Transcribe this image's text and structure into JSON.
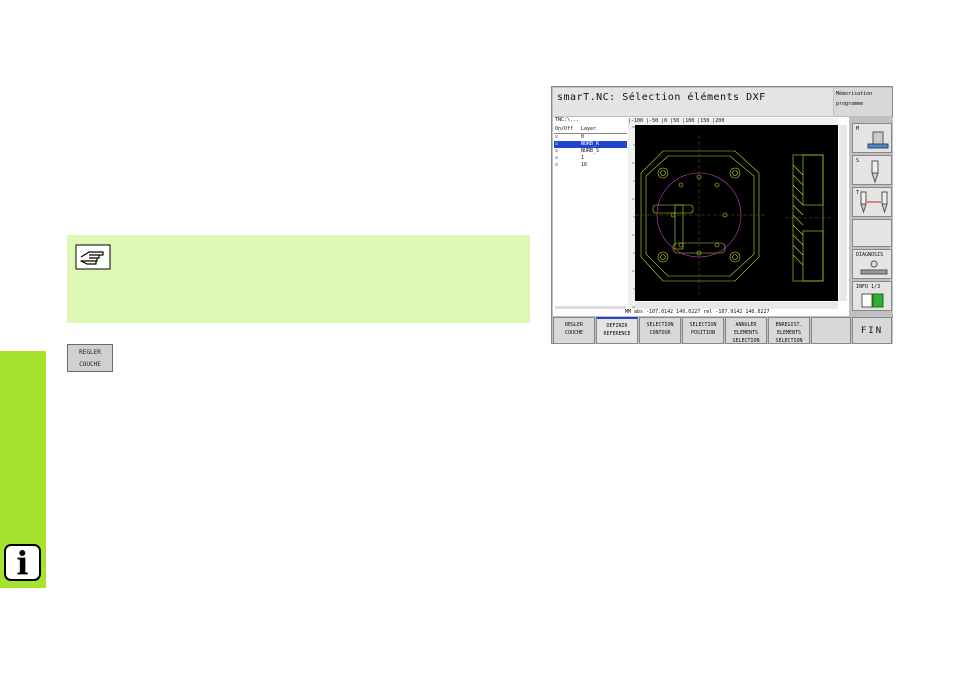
{
  "note_icon": "pointing-hand-icon",
  "softkey_example": {
    "line1": "REGLER",
    "line2": "COUCHE"
  },
  "info_icon": {
    "glyph": "i"
  },
  "screen": {
    "title": "smarT.NC: Sélection éléments DXF",
    "mode": {
      "line1": "Mémorisation",
      "line2": "programme"
    },
    "path": "TNC:\\...",
    "layer_table": {
      "headers": [
        "On/Off",
        "Layer"
      ],
      "rows": [
        {
          "check": "☑",
          "name": "0",
          "selected": false
        },
        {
          "check": "☑",
          "name": "NURB_K",
          "selected": true
        },
        {
          "check": "☑",
          "name": "NURB_S",
          "selected": false
        },
        {
          "check": "☑",
          "name": "1",
          "selected": false
        },
        {
          "check": "☑",
          "name": "16",
          "selected": false
        }
      ]
    },
    "ruler_top": "|-100  |-50  |0   |50  |100 |150  |200",
    "status": "MM   abs -107.0142 140.0227 rel -107.0142 140.0227",
    "right_panel": [
      {
        "label": "M",
        "icon": "spindle-icon"
      },
      {
        "label": "S",
        "icon": "tool-icon"
      },
      {
        "label": "T",
        "icon": "tool-change-icon"
      },
      {
        "label": "",
        "icon": ""
      },
      {
        "label": "DIAGNOSIS",
        "icon": "diagnosis-icon"
      },
      {
        "label": "INFO 1/3",
        "icon": "info-page-icon"
      }
    ],
    "softkeys": [
      "REGLER\nCOUCHE",
      "DEFINIR\nREFERENCE",
      "SELECTION\nCONTOUR",
      "SELECTION\nPOSITION",
      "ANNULER\nELEMENTS\nSELECTION",
      "ENREGIST.\nELEMENTS\nSELECTION",
      "",
      "FIN"
    ]
  },
  "colors": {
    "side_strip": "#a6e22e",
    "note_bg": "#dff7b5",
    "canvas_bg": "#000000",
    "drawing_green": "#c8d820",
    "circle_magenta": "#c040c0",
    "selection_blue": "#2244cc"
  }
}
